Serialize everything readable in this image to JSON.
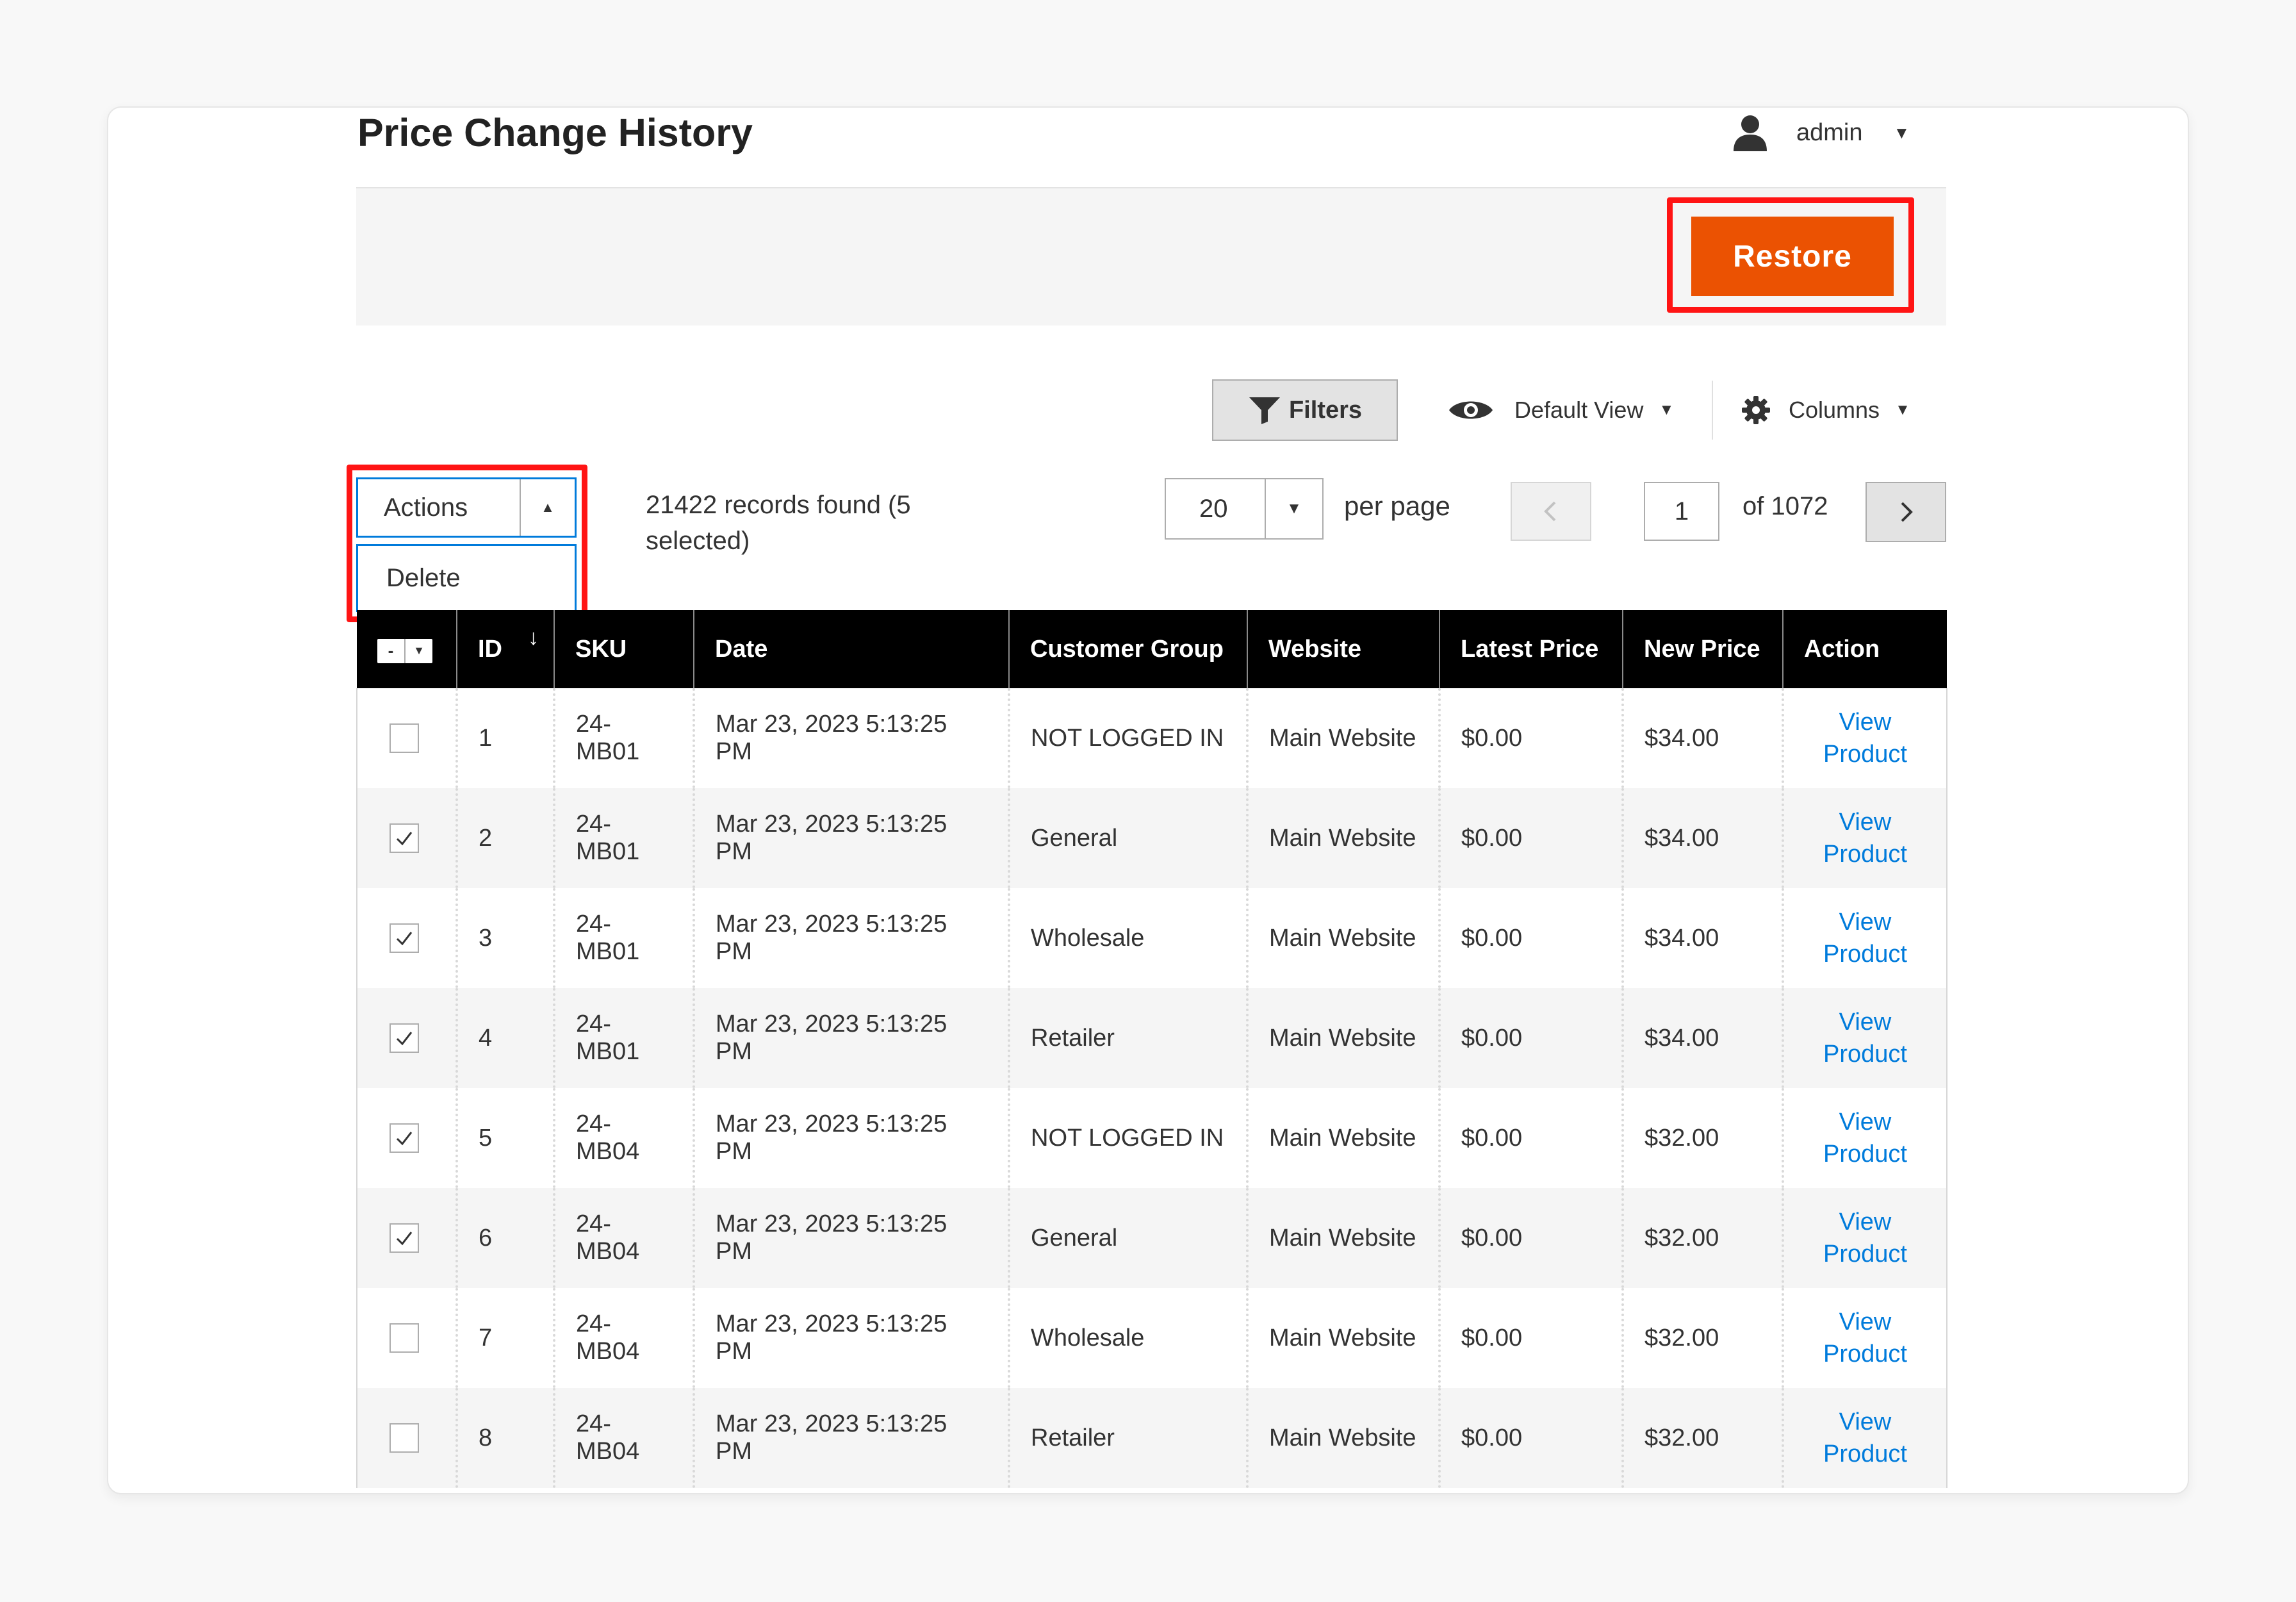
{
  "header": {
    "title": "Price Change History",
    "user_name": "admin",
    "user_icon": "user-icon"
  },
  "action_bar": {
    "restore_label": "Restore",
    "restore_color": "#eb5202",
    "highlight_color": "#ff1414"
  },
  "toolbar": {
    "filters_label": "Filters",
    "view_label": "Default View",
    "columns_label": "Columns"
  },
  "mass_actions": {
    "label": "Actions",
    "options": [
      "Delete"
    ]
  },
  "records": {
    "text": "21422 records found (5 selected)"
  },
  "pagination": {
    "per_page_value": "20",
    "per_page_label": "per page",
    "current_page": "1",
    "total_label": "of 1072"
  },
  "table": {
    "columns": [
      "ID",
      "SKU",
      "Date",
      "Customer Group",
      "Website",
      "Latest Price",
      "New Price",
      "Action"
    ],
    "rows": [
      {
        "checked": false,
        "id": "1",
        "sku": "24-MB01",
        "date": "Mar 23, 2023 5:13:25 PM",
        "group": "NOT LOGGED IN",
        "website": "Main Website",
        "latest": "$0.00",
        "new": "$34.00",
        "link_line1": "View",
        "link_line2": "Product"
      },
      {
        "checked": true,
        "id": "2",
        "sku": "24-MB01",
        "date": "Mar 23, 2023 5:13:25 PM",
        "group": "General",
        "website": "Main Website",
        "latest": "$0.00",
        "new": "$34.00",
        "link_line1": "View",
        "link_line2": "Product"
      },
      {
        "checked": true,
        "id": "3",
        "sku": "24-MB01",
        "date": "Mar 23, 2023 5:13:25 PM",
        "group": "Wholesale",
        "website": "Main Website",
        "latest": "$0.00",
        "new": "$34.00",
        "link_line1": "View",
        "link_line2": "Product"
      },
      {
        "checked": true,
        "id": "4",
        "sku": "24-MB01",
        "date": "Mar 23, 2023 5:13:25 PM",
        "group": "Retailer",
        "website": "Main Website",
        "latest": "$0.00",
        "new": "$34.00",
        "link_line1": "View",
        "link_line2": "Product"
      },
      {
        "checked": true,
        "id": "5",
        "sku": "24-MB04",
        "date": "Mar 23, 2023 5:13:25 PM",
        "group": "NOT LOGGED IN",
        "website": "Main Website",
        "latest": "$0.00",
        "new": "$32.00",
        "link_line1": "View",
        "link_line2": "Product"
      },
      {
        "checked": true,
        "id": "6",
        "sku": "24-MB04",
        "date": "Mar 23, 2023 5:13:25 PM",
        "group": "General",
        "website": "Main Website",
        "latest": "$0.00",
        "new": "$32.00",
        "link_line1": "View",
        "link_line2": "Product"
      },
      {
        "checked": false,
        "id": "7",
        "sku": "24-MB04",
        "date": "Mar 23, 2023 5:13:25 PM",
        "group": "Wholesale",
        "website": "Main Website",
        "latest": "$0.00",
        "new": "$32.00",
        "link_line1": "View",
        "link_line2": "Product"
      },
      {
        "checked": false,
        "id": "8",
        "sku": "24-MB04",
        "date": "Mar 23, 2023 5:13:25 PM",
        "group": "Retailer",
        "website": "Main Website",
        "latest": "$0.00",
        "new": "$32.00",
        "link_line1": "View",
        "link_line2": "Product"
      }
    ]
  }
}
